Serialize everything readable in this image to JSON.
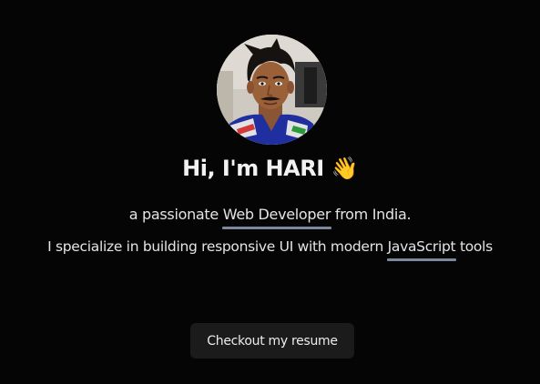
{
  "profile": {
    "avatar_alt": "HARI",
    "greeting": "Hi, I'm HARI",
    "wave_emoji": "👋"
  },
  "intro": {
    "line1_before": "a passionate ",
    "line1_highlight": "Web Developer",
    "line1_after": " from India.",
    "line2_before": "I specialize in building responsive UI with modern ",
    "line2_highlight": "JavaScript",
    "line2_after": " tools"
  },
  "actions": {
    "resume_label": "Checkout my resume"
  },
  "colors": {
    "background": "#050505",
    "underline": "#7d879d",
    "button_bg": "#1b1b1b"
  }
}
